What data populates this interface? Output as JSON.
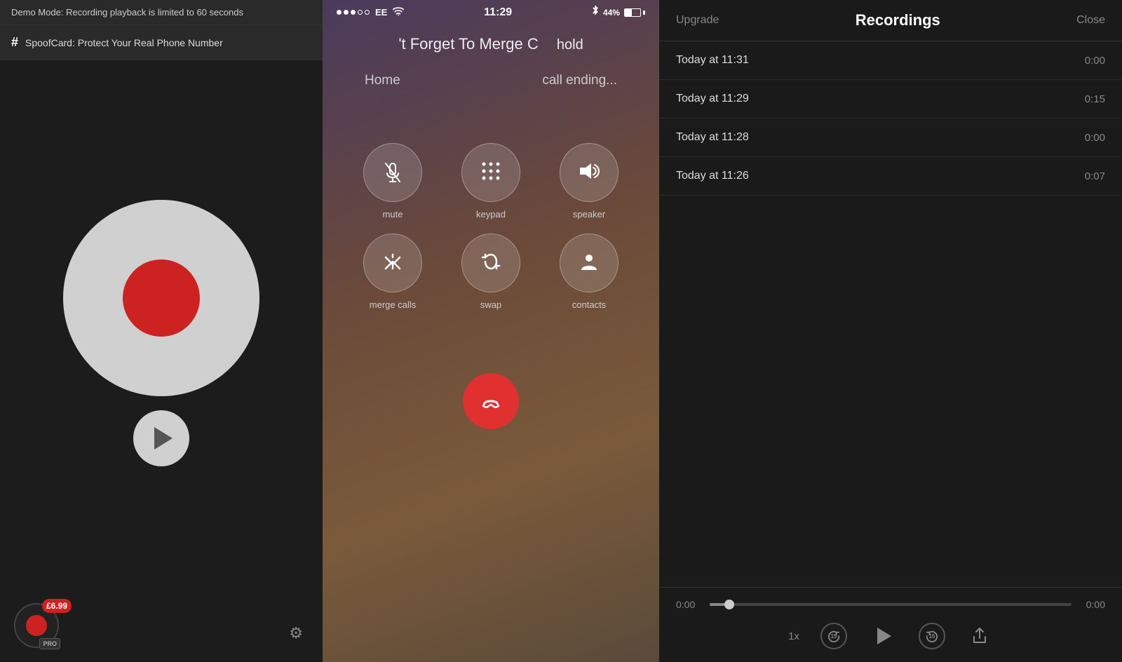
{
  "left": {
    "demo_banner": "Demo Mode: Recording playback is limited to 60 seconds",
    "spoof_label": "SpoofCard: Protect Your Real Phone Number",
    "price": "£6.99",
    "pro_label": "PRO"
  },
  "middle": {
    "status": {
      "carrier": "EE",
      "time": "11:29",
      "battery": "44%"
    },
    "call_title": "'t Forget To Merge C",
    "call_hold": "hold",
    "call_contact": "Home",
    "call_status": "call ending...",
    "buttons": [
      {
        "id": "mute",
        "label": "mute",
        "icon": "mic-slash"
      },
      {
        "id": "keypad",
        "label": "keypad",
        "icon": "keypad"
      },
      {
        "id": "speaker",
        "label": "speaker",
        "icon": "speaker"
      },
      {
        "id": "merge-calls",
        "label": "merge calls",
        "icon": "merge"
      },
      {
        "id": "swap",
        "label": "swap",
        "icon": "swap"
      },
      {
        "id": "contacts",
        "label": "contacts",
        "icon": "person"
      }
    ]
  },
  "right": {
    "title": "Recordings",
    "upgrade_label": "Upgrade",
    "close_label": "Close",
    "recordings": [
      {
        "label": "Today at 11:31",
        "duration": "0:00"
      },
      {
        "label": "Today at 11:29",
        "duration": "0:15"
      },
      {
        "label": "Today at 11:28",
        "duration": "0:00"
      },
      {
        "label": "Today at 11:26",
        "duration": "0:07"
      }
    ],
    "player": {
      "current_time": "0:00",
      "total_time": "0:00",
      "speed": "1x",
      "skip_back": "15",
      "skip_forward": "15"
    }
  }
}
